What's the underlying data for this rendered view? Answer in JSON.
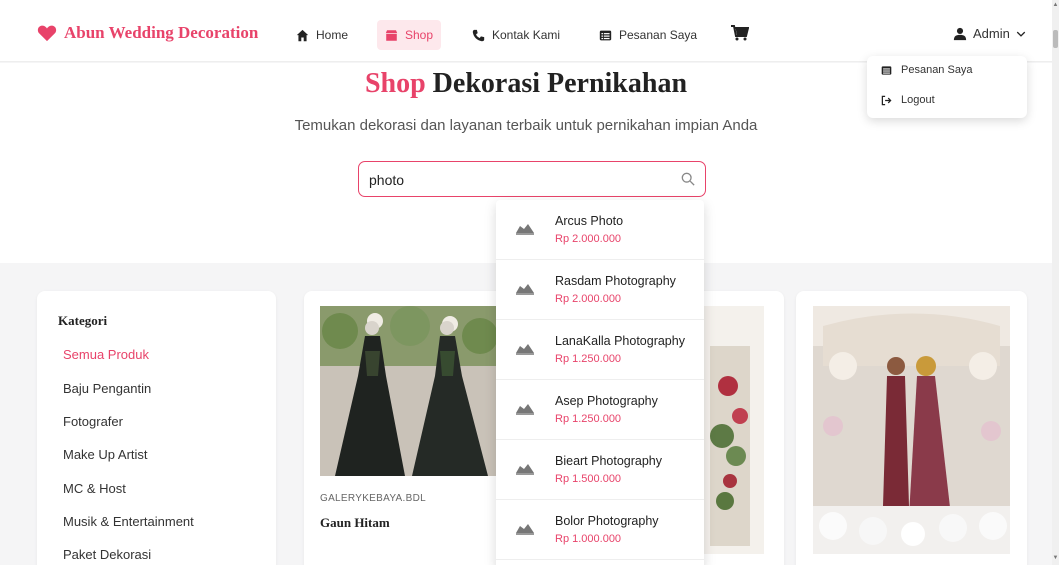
{
  "brand": {
    "name": "Abun Wedding Decoration"
  },
  "nav": {
    "home": "Home",
    "shop": "Shop",
    "kontak": "Kontak Kami",
    "pesanan": "Pesanan Saya",
    "admin": "Admin"
  },
  "user_menu": {
    "pesanan": "Pesanan Saya",
    "logout": "Logout"
  },
  "hero": {
    "title_accent": "Shop",
    "title_rest": " Dekorasi Pernikahan",
    "subtitle": "Temukan dekorasi dan layanan terbaik untuk pernikahan impian Anda"
  },
  "search": {
    "value": "photo"
  },
  "results": [
    {
      "name": "Arcus Photo",
      "price": "Rp 2.000.000"
    },
    {
      "name": "Rasdam Photography",
      "price": "Rp 2.000.000"
    },
    {
      "name": "LanaKalla Photography",
      "price": "Rp 1.250.000"
    },
    {
      "name": "Asep Photography",
      "price": "Rp 1.250.000"
    },
    {
      "name": "Bieart Photography",
      "price": "Rp 1.500.000"
    },
    {
      "name": "Bolor Photography",
      "price": "Rp 1.000.000"
    }
  ],
  "sidebar": {
    "title": "Kategori",
    "items": [
      "Semua Produk",
      "Baju Pengantin",
      "Fotografer",
      "Make Up Artist",
      "MC & Host",
      "Musik & Entertainment",
      "Paket Dekorasi"
    ]
  },
  "products": [
    {
      "vendor": "GALERYKEBAYA.BDL",
      "name": "Gaun Hitam"
    }
  ],
  "colors": {
    "accent": "#e8436a",
    "accent_bg": "#fde8ec",
    "page_bg": "#f5f5f6"
  }
}
